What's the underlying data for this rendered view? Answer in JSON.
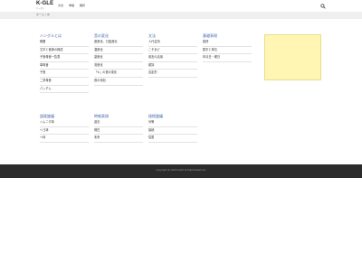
{
  "header": {
    "logo": "K-GLE",
    "logo_sub": "ケーグル",
    "nav": [
      "文法",
      "単語",
      "翻訳"
    ]
  },
  "breadcrumb": "ホーム / 文",
  "sections": [
    {
      "title": "ハングルとは",
      "items": [
        "概要",
        "文字と音節の構成",
        "子音母音一覧表",
        "単母音",
        "子音",
        "二重母音",
        "パッチム"
      ]
    },
    {
      "title": "音の変化",
      "items": [
        "連音化、口蓋音化",
        "濃音化",
        "激音化",
        "流音化",
        "「ㅎ」の音の変化",
        "音の添加"
      ]
    },
    {
      "title": "文法",
      "items": [
        "人代名詞",
        "こそあど",
        "用言の活用",
        "助詞",
        "否定形"
      ]
    },
    {
      "title": "基礎表現",
      "items": [
        "挨拶",
        "数字と単位",
        "年月日・曜日"
      ]
    },
    {
      "title": "語尾論議",
      "items": [
        "ハムニダ体",
        "ヘヨ体",
        "ヘ体"
      ]
    },
    {
      "title": "時制表現",
      "items": [
        "過去",
        "現在",
        "未来"
      ]
    },
    {
      "title": "接続論議",
      "items": [
        "対等",
        "接続",
        "従属"
      ]
    }
  ],
  "footer": {
    "copyright": "Copyright (C) 2020 K-GLE All Rights Reserved."
  },
  "colors": {
    "accent": "#3b64a8",
    "footer_bg": "#2b2b2b",
    "ad_bg": "#fff6b3"
  }
}
